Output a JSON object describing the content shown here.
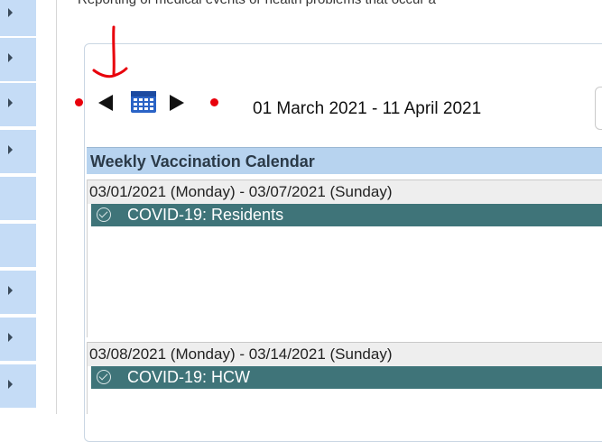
{
  "page": {
    "intro_text": "Reporting of medical events or health problems that occur a"
  },
  "calendar": {
    "date_range": "01 March 2021  -  11 April 2021",
    "header": "Weekly Vaccination Calendar",
    "weeks": [
      {
        "label": "03/01/2021 (Monday) - 03/07/2021 (Sunday)",
        "events": [
          {
            "label": "COVID-19: Residents",
            "status_icon": "check-circle-icon"
          }
        ]
      },
      {
        "label": "03/08/2021 (Monday) - 03/14/2021 (Sunday)",
        "events": [
          {
            "label": "COVID-19: HCW",
            "status_icon": "check-circle-icon"
          }
        ]
      }
    ]
  },
  "icons": {
    "prev": "previous-arrow-icon",
    "calendar": "calendar-icon",
    "next": "next-arrow-icon"
  },
  "colors": {
    "header_bg": "#b7d3ef",
    "event_bg": "#3f7479",
    "annotation_red": "#e8000b",
    "rail_bg": "#c5dcf6"
  }
}
